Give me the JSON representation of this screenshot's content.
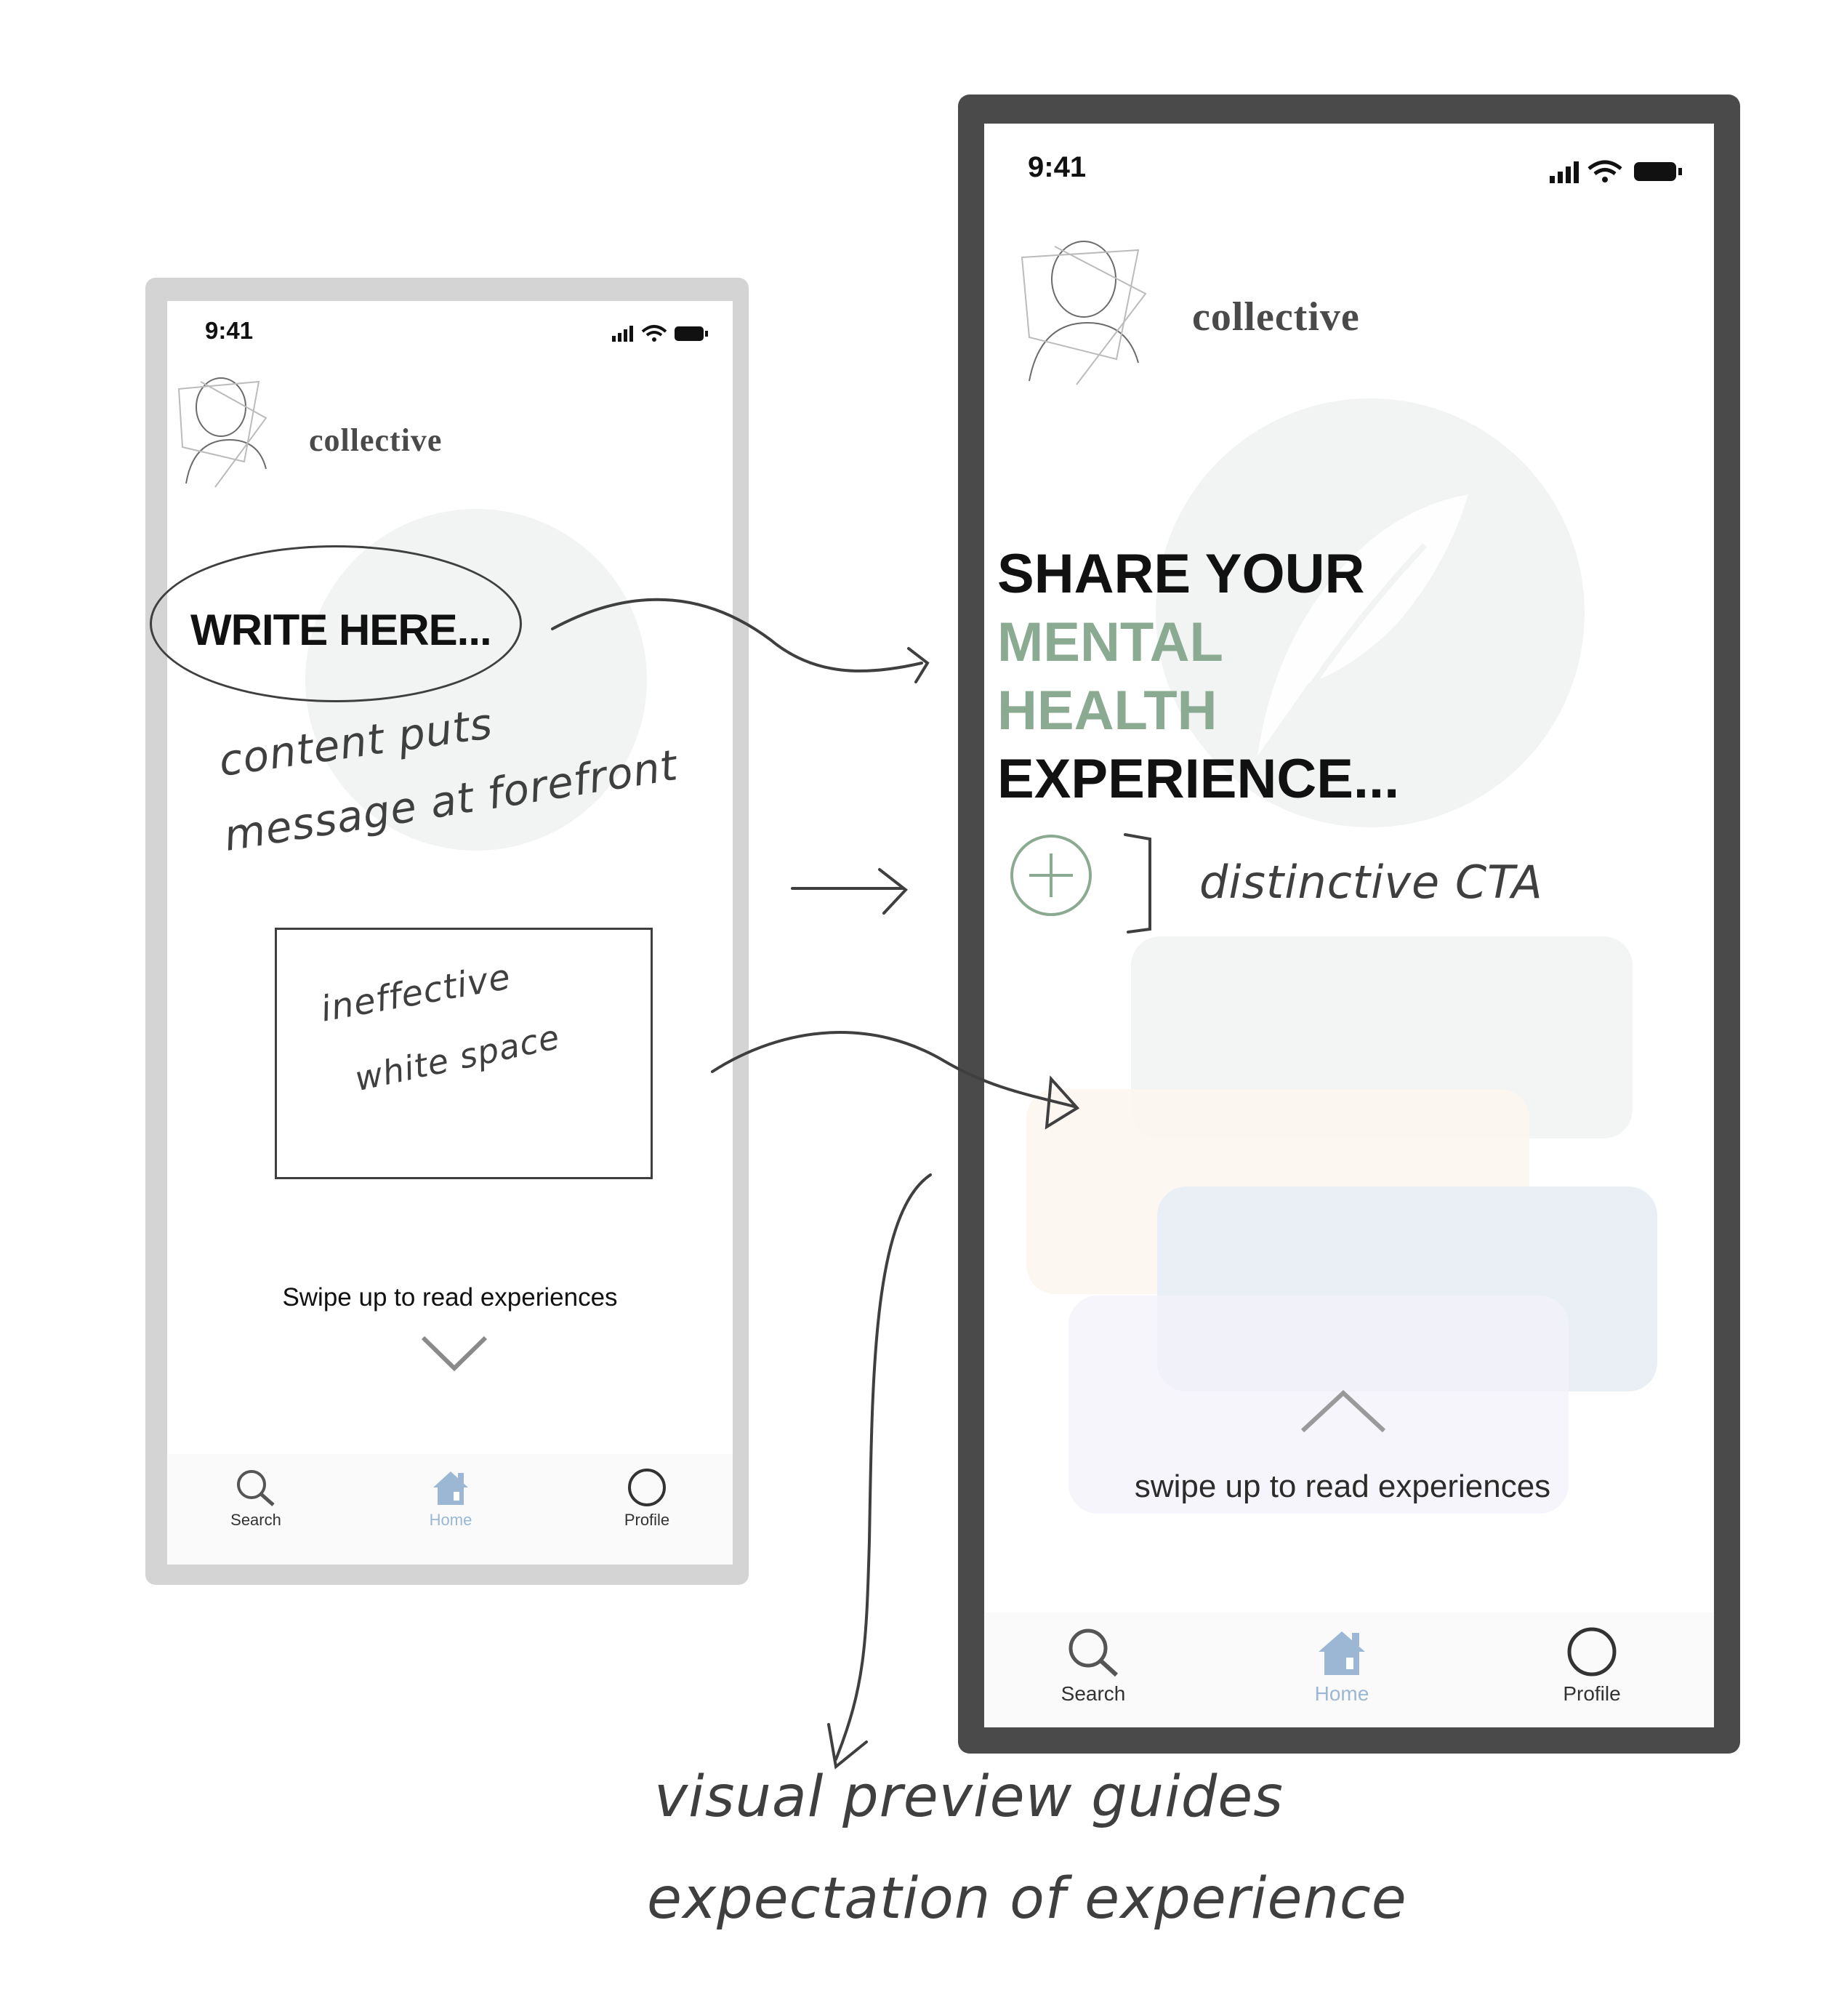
{
  "old_screen": {
    "time": "9:41",
    "brand": "collective",
    "heading": "WRITE HERE...",
    "swipe_text": "Swipe up to read experiences",
    "tabs": [
      {
        "label": "Search",
        "icon": "search-icon",
        "active": false
      },
      {
        "label": "Home",
        "icon": "home-icon",
        "active": true
      },
      {
        "label": "Profile",
        "icon": "profile-icon",
        "active": false
      }
    ]
  },
  "new_screen": {
    "time": "9:41",
    "brand": "collective",
    "headline": [
      "SHARE YOUR",
      "MENTAL",
      "HEALTH",
      "EXPERIENCE..."
    ],
    "swipe_text": "swipe up to read experiences",
    "tabs": [
      {
        "label": "Search",
        "icon": "search-icon",
        "active": false
      },
      {
        "label": "Home",
        "icon": "home-icon",
        "active": true
      },
      {
        "label": "Profile",
        "icon": "profile-icon",
        "active": false
      }
    ]
  },
  "annotations": {
    "content_line1": "content puts",
    "content_line2": "message at forefront",
    "white_space_line1": "ineffective",
    "white_space_line2": "white space",
    "cta_note": "distinctive CTA",
    "preview_line1": "visual preview guides",
    "preview_line2": "expectation of experience"
  },
  "colors": {
    "accent_green": "#8aab92",
    "tab_active": "#9bb7d4",
    "tab_inactive": "#555555",
    "frame_dark": "#4a4a4a",
    "frame_light": "#d4d4d4"
  }
}
